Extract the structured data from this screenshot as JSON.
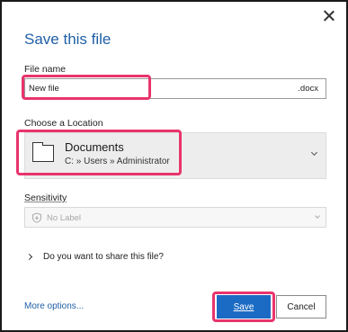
{
  "dialog": {
    "title": "Save this file",
    "close_icon": "close-icon"
  },
  "file_name": {
    "label": "File name",
    "value": "New file",
    "extension": ".docx"
  },
  "location": {
    "label": "Choose a Location",
    "name": "Documents",
    "path": "C: » Users » Administrator",
    "icon": "folder-icon"
  },
  "sensitivity": {
    "label": "Sensitivity",
    "value": "No Label",
    "icon": "shield-icon",
    "disabled": true
  },
  "share": {
    "text": "Do you want to share this file?"
  },
  "footer": {
    "more_options": "More options...",
    "save_label": "Save",
    "cancel_label": "Cancel"
  },
  "colors": {
    "title": "#1f5fa6",
    "primary_button": "#1b6bc4",
    "highlight": "#e8346c"
  }
}
